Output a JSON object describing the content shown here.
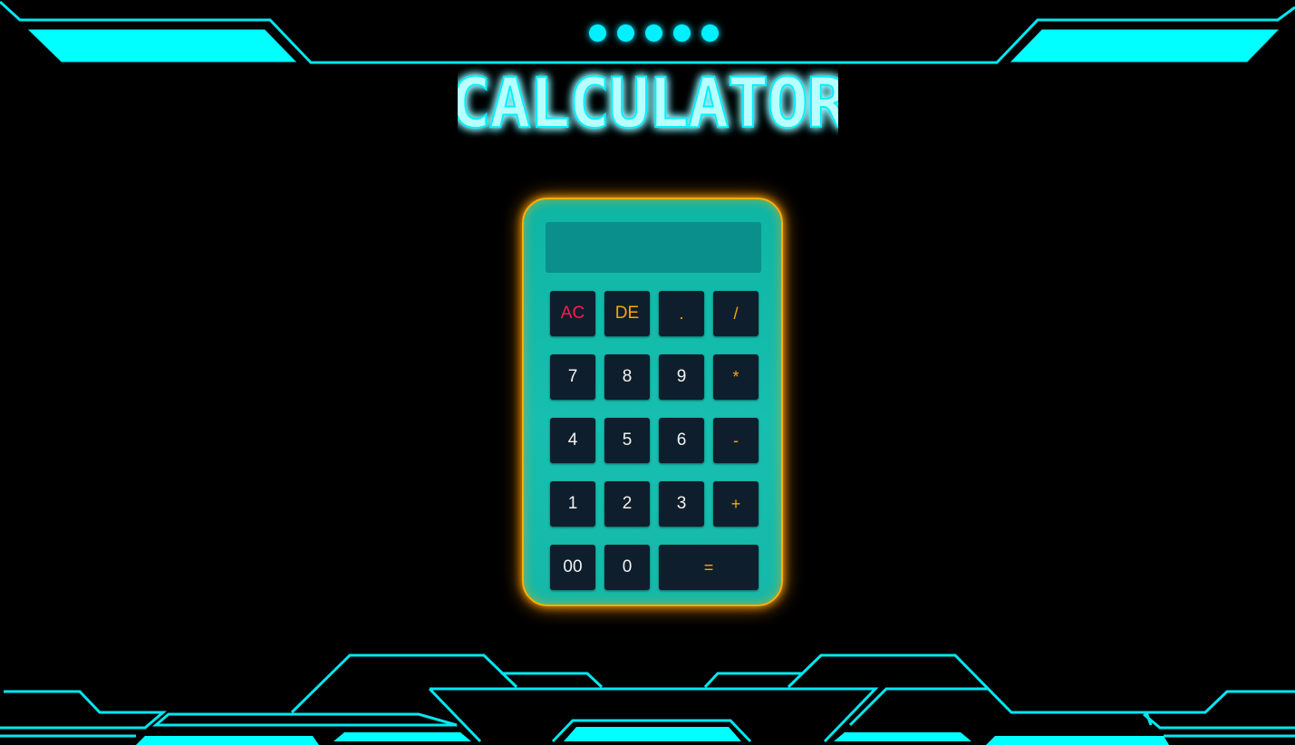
{
  "page": {
    "title": "CALCULATOR",
    "status_dots": 5
  },
  "calculator": {
    "display_value": "",
    "keys": [
      {
        "label": "AC",
        "kind": "clear"
      },
      {
        "label": "DE",
        "kind": "delete"
      },
      {
        "label": ".",
        "kind": "op"
      },
      {
        "label": "/",
        "kind": "op"
      },
      {
        "label": "7",
        "kind": "digit"
      },
      {
        "label": "8",
        "kind": "digit"
      },
      {
        "label": "9",
        "kind": "digit"
      },
      {
        "label": "*",
        "kind": "op"
      },
      {
        "label": "4",
        "kind": "digit"
      },
      {
        "label": "5",
        "kind": "digit"
      },
      {
        "label": "6",
        "kind": "digit"
      },
      {
        "label": "-",
        "kind": "op"
      },
      {
        "label": "1",
        "kind": "digit"
      },
      {
        "label": "2",
        "kind": "digit"
      },
      {
        "label": "3",
        "kind": "digit"
      },
      {
        "label": "+",
        "kind": "op"
      },
      {
        "label": "00",
        "kind": "digit"
      },
      {
        "label": "0",
        "kind": "digit"
      },
      {
        "label": "=",
        "kind": "equals"
      }
    ]
  },
  "colors": {
    "neon_cyan": "#00f0ff",
    "glow_orange": "#ffa500",
    "clear_red": "#ff1a4a",
    "key_bg": "#0f1e2d",
    "body_teal": "#17bfb0"
  }
}
